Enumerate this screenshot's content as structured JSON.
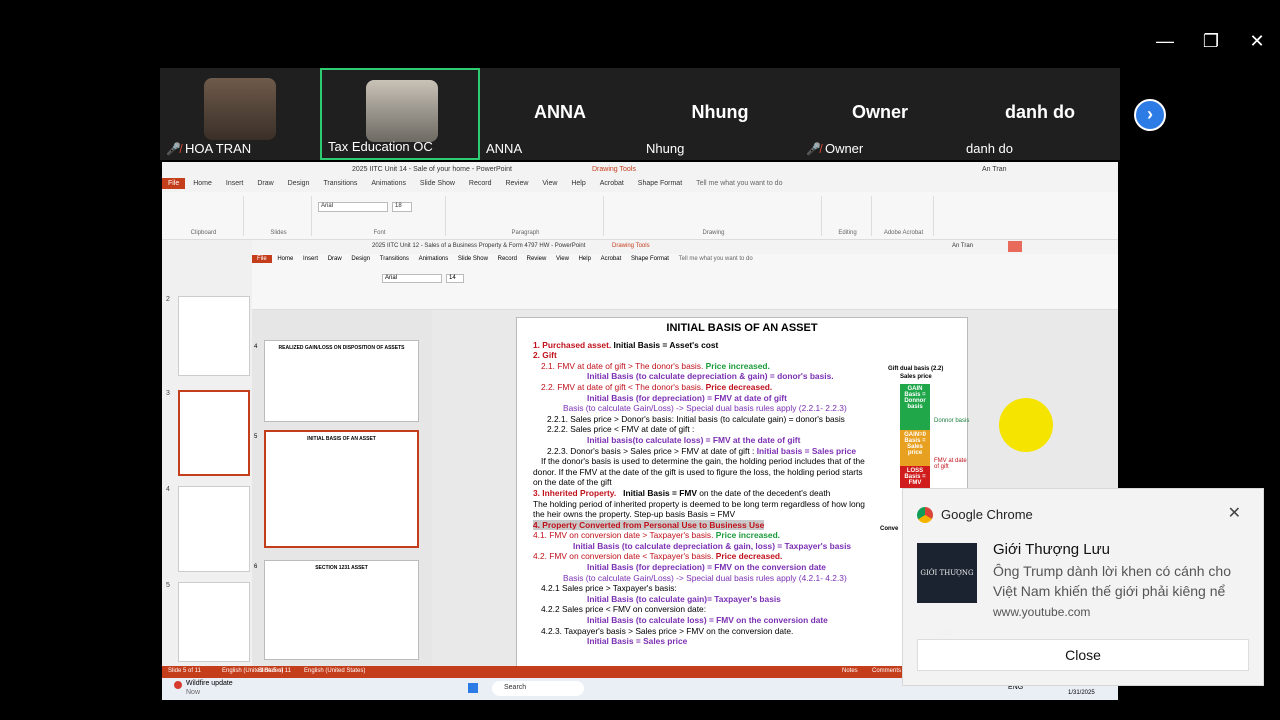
{
  "window": {
    "minimize": "—",
    "restore": "❐",
    "close": "✕"
  },
  "participants": [
    {
      "name": "HOA TRAN",
      "muted": true,
      "has_video": true
    },
    {
      "name": "Tax Education OC",
      "muted": false,
      "has_video": true,
      "active": true
    },
    {
      "name": "ANNA",
      "big_name": "ANNA",
      "muted": false
    },
    {
      "name": "Nhung",
      "big_name": "Nhung",
      "muted": false
    },
    {
      "name": "Owner",
      "big_name": "Owner",
      "muted": true
    },
    {
      "name": "danh do",
      "big_name": "danh do",
      "muted": false
    }
  ],
  "next_icon": "›",
  "ppt": {
    "title": "2025 IITC Unit 14 - Sale of your home - PowerPoint",
    "drawing_tools": "Drawing Tools",
    "user": "An Tran",
    "tabs": [
      "File",
      "Home",
      "Insert",
      "Draw",
      "Design",
      "Transitions",
      "Animations",
      "Slide Show",
      "Record",
      "Review",
      "View",
      "Help",
      "Acrobat",
      "Shape Format"
    ],
    "tell_me": "Tell me what you want to do",
    "groups": [
      "Clipboard",
      "Slides",
      "Font",
      "Paragraph",
      "Drawing",
      "Editing",
      "Adobe Acrobat"
    ],
    "font_name": "Arial",
    "font_size": "18",
    "status_left": "Slide 5 of 11",
    "status_lang": "English (United States)"
  },
  "inner_ppt": {
    "title": "2025 IITC Unit 12 - Sales of a Business Property & Form 4797 HW - PowerPoint",
    "drawing_tools": "Drawing Tools",
    "user": "An Tran",
    "tabs": [
      "File",
      "Home",
      "Insert",
      "Draw",
      "Design",
      "Transitions",
      "Animations",
      "Slide Show",
      "Record",
      "Review",
      "View",
      "Help",
      "Acrobat",
      "Shape Format"
    ],
    "tell_me": "Tell me what you want to do",
    "font_name": "Arial",
    "font_size": "14",
    "thumb_numbers": [
      "4",
      "5",
      "6"
    ],
    "thumb_labels": [
      "REALIZED GAIN/LOSS ON DISPOSITION OF ASSETS",
      "INITIAL BASIS OF AN ASSET",
      "SECTION 1231 ASSET"
    ],
    "status_left": "Slide 5 of 11",
    "status_lang": "English (United States)",
    "notes": "Notes",
    "comments": "Comments"
  },
  "outer_thumb_numbers": [
    "2",
    "3",
    "4",
    "5"
  ],
  "slide": {
    "title": "INITIAL BASIS OF AN ASSET",
    "l1a": "1. Purchased asset.",
    "l1b": "Initial Basis = Asset's cost",
    "l2": "2. Gift",
    "l21a": "2.1. FMV at date of gift > The donor's basis.",
    "l21b": "Price increased.",
    "l21c": "Initial Basis (to calculate depreciation & gain) = donor's basis.",
    "l22a": "2.2. FMV at date of gift < The donor's basis.",
    "l22b": "Price decreased.",
    "l22c": "Initial Basis (for depreciation) = FMV at date of gift",
    "l22d": "Basis (to calculate Gain/Loss) -> Special dual basis rules apply (2.2.1- 2.2.3)",
    "l221": "2.2.1. Sales price > Donor's basis: Initial basis (to calculate gain) = donor's basis",
    "l222": "2.2.2. Sales price < FMV at date of gift :",
    "l222b": "Initial basis(to calculate loss) = FMV at the date of gift",
    "l223a": "2.2.3. Donor's basis > Sales price > FMV at date of gift :",
    "l223b": "Initial basis = Sales price",
    "p1": "If the donor's basis is used to determine the gain, the holding period includes that of the",
    "p2": "donor. If the FMV at the date of the gift is used to figure the loss, the holding period starts",
    "p3": "on the date of the gift",
    "l3a": "3. Inherited Property.",
    "l3b": "Initial Basis = FMV",
    "l3c": "on the date of the decedent's death",
    "p4": "The holding period of inherited property is deemed to be long term regardless of how long",
    "p5": "the heir owns the property. Step-up basis   Basis = FMV",
    "l4": "4. Property Converted from Personal Use to Business Use",
    "l41a": "4.1. FMV on conversion date > Taxpayer's basis.",
    "l41b": "Price increased.",
    "l41c": "Initial Basis (to calculate depreciation & gain, loss) = Taxpayer's basis",
    "l42a": "4.2. FMV on conversion date < Taxpayer's basis.",
    "l42b": "Price decreased.",
    "l42c": "Initial Basis (for depreciation) = FMV on the conversion date",
    "l42d": "Basis (to calculate Gain/Loss) -> Special dual basis rules apply (4.2.1- 4.2.3)",
    "l421": "4.2.1 Sales price > Taxpayer's basis:",
    "l421b": "Initial Basis (to calculate gain)= Taxpayer's basis",
    "l422": "4.2.2 Sales price < FMV on conversion date:",
    "l422b": "Initial Basis (to calculate loss) = FMV on the conversion date",
    "l423": "4.2.3. Taxpayer's basis > Sales price > FMV on the conversion date.",
    "l423b": "Initial Basis = Sales price"
  },
  "dual_chart": {
    "title": "Gift dual basis (2.2)",
    "subtitle": "Sales price",
    "gain": "GAIN Basis = Donnor basis",
    "zero": "GAIN=0 Basis = Sales price",
    "loss": "LOSS Basis = FMV",
    "donor_label": "Donnor basis",
    "fmv_label": "FMV at date of gift",
    "conv_label": "Conve",
    "colors": {
      "gain": "#1fa74a",
      "zero": "#e8a020",
      "loss": "#d01c1c"
    }
  },
  "taskbar": {
    "weather": "Wildfire update",
    "weather_sub": "Now",
    "search": "Search",
    "lang": "ENG",
    "date": "1/31/2025"
  },
  "notification": {
    "app": "Google Chrome",
    "title": "Giới Thượng Lưu",
    "body": "Ông Trump dành lời khen có cánh cho Việt Nam khiến thế giới phải kiêng nể",
    "source": "www.youtube.com",
    "close_label": "Close",
    "thumb_text": "GIỚI THƯỢNG LƯU"
  }
}
